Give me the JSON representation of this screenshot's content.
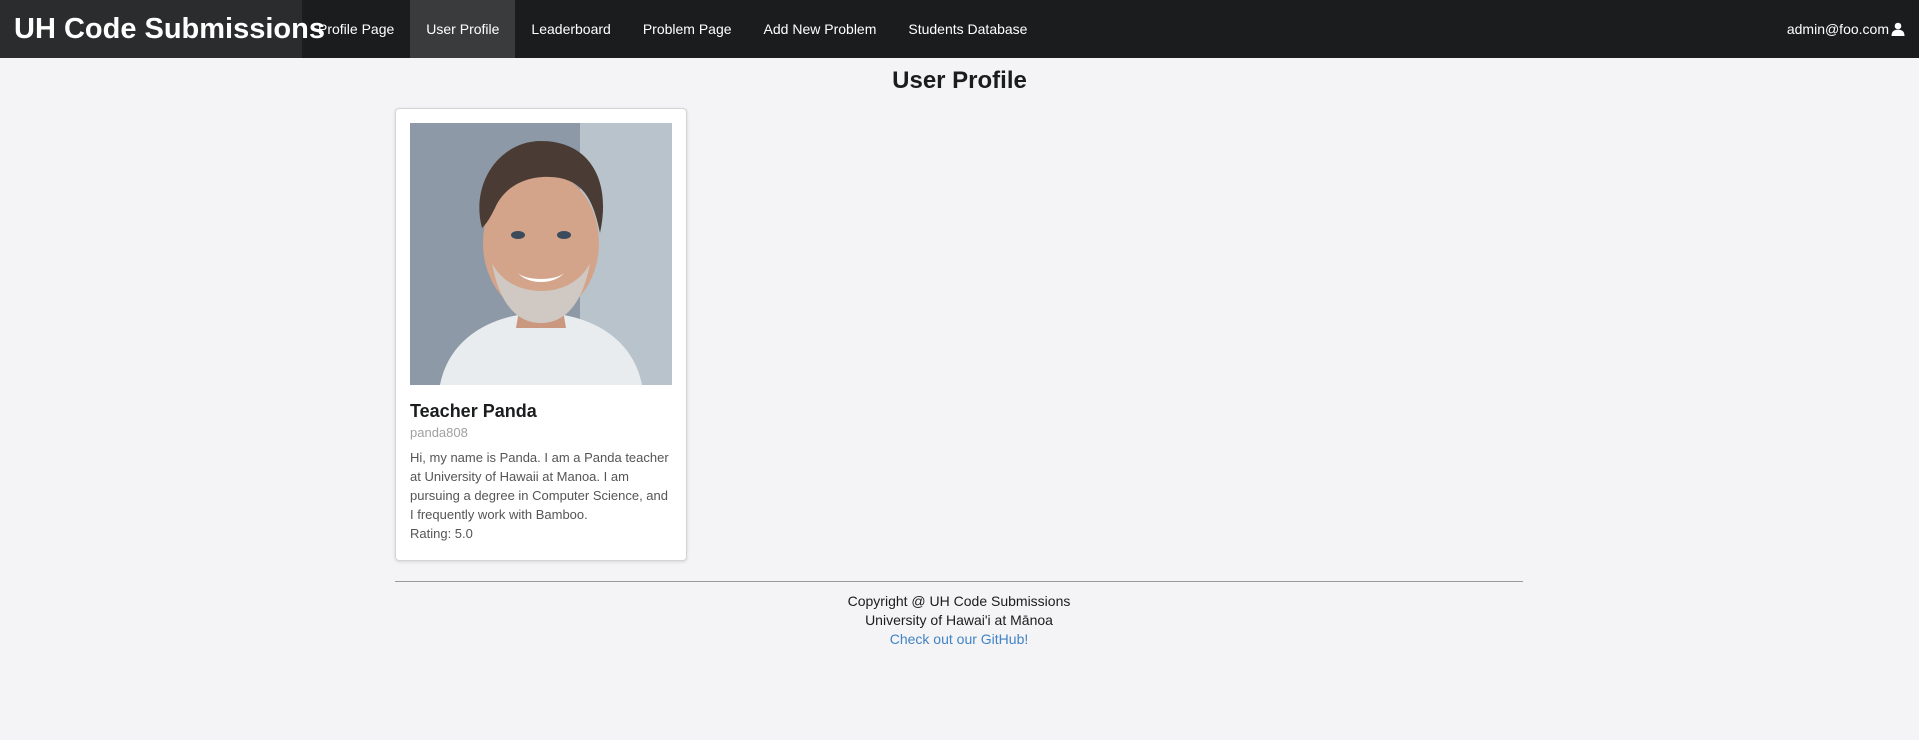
{
  "navbar": {
    "brand": "UH Code Submissions",
    "items": [
      {
        "label": "Profile Page"
      },
      {
        "label": "User Profile"
      },
      {
        "label": "Leaderboard"
      },
      {
        "label": "Problem Page"
      },
      {
        "label": "Add New Problem"
      },
      {
        "label": "Students Database"
      }
    ],
    "user": "admin@foo.com",
    "user_icon": "user-icon"
  },
  "page": {
    "title": "User Profile"
  },
  "profile_card": {
    "name": "Teacher Panda",
    "username": "panda808",
    "description": "Hi, my name is Panda. I am a Panda teacher at University of Hawaii at Manoa. I am pursuing a degree in Computer Science, and I frequently work with Bamboo.",
    "rating": "Rating: 5.0"
  },
  "footer": {
    "copyright": "Copyright @ UH Code Submissions",
    "university": "University of Hawai'i at Mānoa",
    "github_link": "Check out our GitHub!"
  },
  "colors": {
    "navbar_bg": "#1b1c1d",
    "link": "#4183c4",
    "page_bg": "#f4f4f6"
  }
}
